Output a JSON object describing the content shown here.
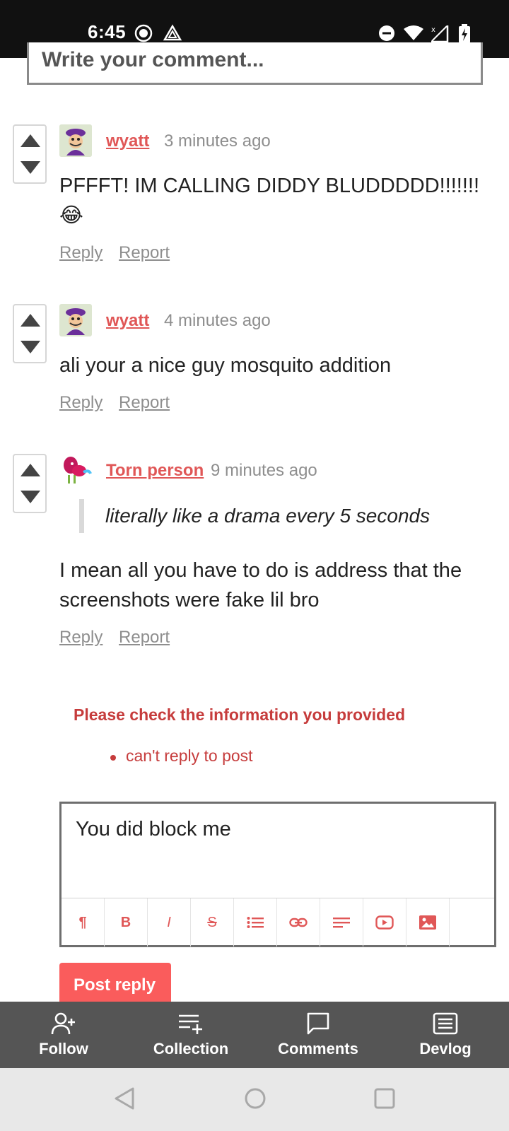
{
  "status_bar": {
    "time": "6:45",
    "icons": [
      "record-icon",
      "drive-icon",
      "dnd-icon",
      "wifi-icon",
      "signal-off-icon",
      "battery-charging-icon"
    ]
  },
  "comment_input": {
    "placeholder": "Write your comment..."
  },
  "comments": [
    {
      "author": "wyatt",
      "time": "3 minutes ago",
      "body": "PFFFT! IM CALLING DIDDY BLUDDDDD!!!!!!! 😂",
      "quote": "",
      "reply_label": "Reply",
      "report_label": "Report"
    },
    {
      "author": "wyatt",
      "time": "4 minutes ago",
      "body": "ali your a nice guy mosquito addition",
      "quote": "",
      "reply_label": "Reply",
      "report_label": "Report"
    },
    {
      "author": "Torn person",
      "time": "9 minutes ago",
      "quote": "literally like a drama every 5 seconds",
      "body": "I mean all you have to do is address that the screenshots were fake lil bro",
      "reply_label": "Reply",
      "report_label": "Report"
    }
  ],
  "error": {
    "title": "Please check the information you provided",
    "items": [
      "can't reply to post"
    ]
  },
  "reply_editor": {
    "value": "You did block me",
    "toolbar": [
      "paragraph-icon",
      "bold-icon",
      "italic-icon",
      "strikethrough-icon",
      "list-icon",
      "link-icon",
      "align-icon",
      "video-icon",
      "image-icon"
    ],
    "paragraph_glyph": "¶",
    "bold_glyph": "B",
    "italic_glyph": "I",
    "strike_glyph": "S"
  },
  "post_button": "Post reply",
  "bottom_nav": [
    {
      "label": "Follow",
      "icon": "follow-icon"
    },
    {
      "label": "Collection",
      "icon": "collection-icon"
    },
    {
      "label": "Comments",
      "icon": "comments-icon"
    },
    {
      "label": "Devlog",
      "icon": "devlog-icon"
    }
  ],
  "colors": {
    "accent": "#fa5c5c",
    "author": "#e05757",
    "error": "#c63c3c",
    "nav_bg": "#555555"
  }
}
